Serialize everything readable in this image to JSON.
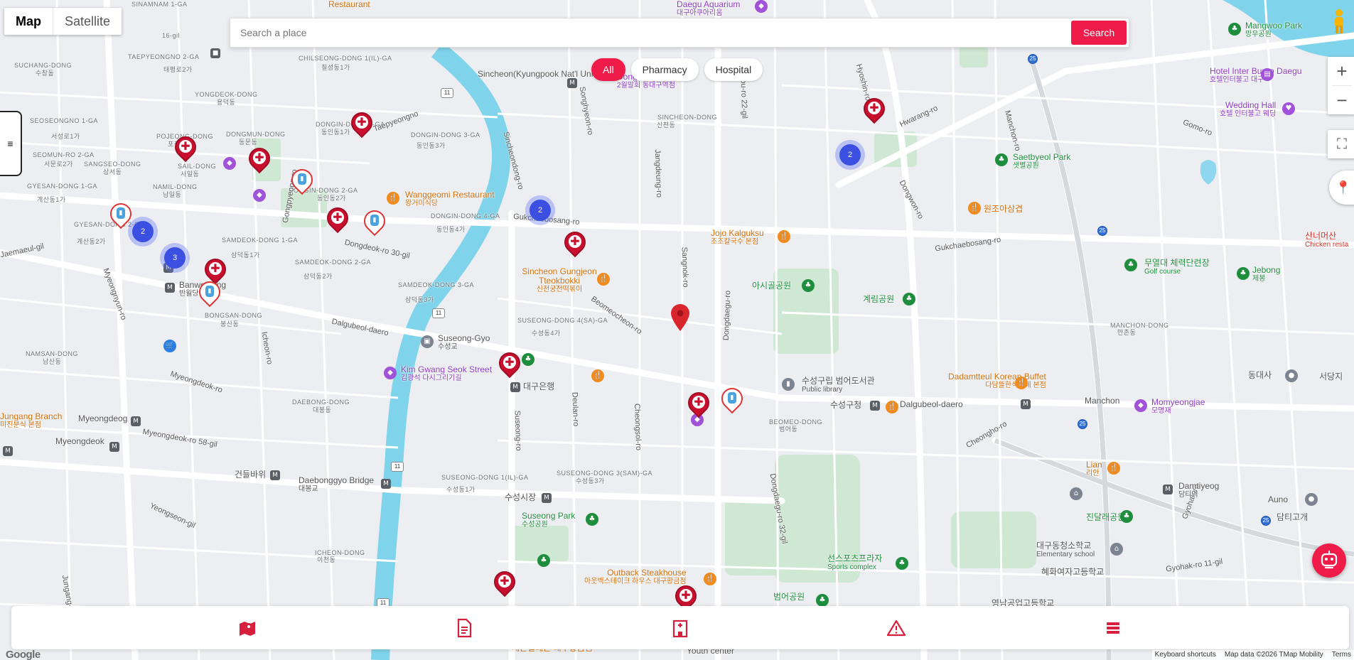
{
  "map_type": {
    "map_label": "Map",
    "satellite_label": "Satellite"
  },
  "search": {
    "placeholder": "Search a place",
    "button_label": "Search"
  },
  "filters": [
    {
      "label": "All",
      "active": true
    },
    {
      "label": "Pharmacy",
      "active": false
    },
    {
      "label": "Hospital",
      "active": false
    }
  ],
  "controls": {
    "zoom_in": "+",
    "zoom_out": "−",
    "fullscreen": "⛶",
    "menu_toggle": "≡"
  },
  "map": {
    "districts": [
      "SINAMNAM 1-GA",
      "16-gil",
      "SUCHANG-DONG",
      "수창동",
      "TAEPYEONGNO 2-GA",
      "태평로2가",
      "SEOSEONGNO 1-GA",
      "서성로1가",
      "SEOMUN-RO 2-GA",
      "서문로2가",
      "SANGSEO-DONG",
      "상서동",
      "GYESAN-DONG 1-GA",
      "계산동1가",
      "NAMIL-DONG",
      "남일동",
      "GYESAN-DONG 2-GA",
      "계산동2가",
      "YONGDEOK-DONG",
      "용덕동",
      "POJEONG-DONG",
      "포정동",
      "SAIL-DONG",
      "사일동",
      "DONGMUN-DONG",
      "동문동",
      "CHILSEONG-DONG 1(IL)-GA",
      "칠성동1가",
      "DONGIN-DONG 1-GA",
      "동인동1가",
      "DONGIN-DONG 2-GA",
      "동인동2가",
      "DONGIN-DONG 3-GA",
      "동인동3가",
      "DONGIN-DONG 4-GA",
      "동인동4가",
      "SAMDEOK-DONG 1-GA",
      "삼덕동1가",
      "SAMDEOK-DONG 2-GA",
      "삼덕동2가",
      "SAMDEOK-DONG 3-GA",
      "삼덕동3가",
      "BONGSAN-DONG",
      "봉산동",
      "NAMSAN-DONG",
      "남산동",
      "DAEBONG-DONG",
      "대봉동",
      "ICHEON-DONG",
      "이천동",
      "SUSEONG-DONG 4(SA)-GA",
      "수성동4가",
      "SUSEONG-DONG 3(SAM)-GA",
      "수성동3가",
      "SUSEONG-DONG 1(IL)-GA",
      "수성동1가",
      "SINCHEON-DONG",
      "신천동",
      "BEOMEO-DONG",
      "범어동",
      "MANCHON-DONG",
      "만촌동"
    ],
    "roads": [
      "Taepyeongno",
      "Dongdeok-ro 30-gil",
      "Gongpyeong-ro",
      "Gukchaebosang-ro",
      "Dalgubeol-daero",
      "Myeongdeok-ro",
      "Myeongnyun-ro",
      "Myeongdeok-ro 58-gil",
      "Icheon-ro",
      "Sincheondong-ro",
      "Songhyeon-ro",
      "Beomeocheon-ro",
      "Sangnok-ro",
      "Jangdeung-ro",
      "Dongdaegu-ro",
      "Dongbu-ro 22-gil",
      "Hwarang-ro",
      "Hyoshin-ro",
      "Manchon-ro",
      "Dongwon-ro",
      "Gomo-ro",
      "Gukchaebosang-ro",
      "Cheongho-ro",
      "Gyohak-ro",
      "Gyohak-ro 11-gil",
      "Jungang-daero",
      "Suseong-ro",
      "Deulan-ro",
      "Cheongsol-ro",
      "Jaemaeul-gil",
      "Yeongseon-gil",
      "Dongdaegu-ro 32-gil"
    ],
    "pois": [
      {
        "name": "Wanggeomi Restaurant",
        "sub": "왕거미식당",
        "color": "orange"
      },
      {
        "name": "Sincheon(Kyungpook Nat'l Univ)",
        "sub": "",
        "color": "gray"
      },
      {
        "name": "Sincheon Gungjeon Tteokbokki",
        "sub": "신천궁전떡볶이",
        "color": "orange"
      },
      {
        "name": "Suseong-Gyo",
        "sub": "수성교",
        "color": "gray"
      },
      {
        "name": "Kim Gwang Seok Street",
        "sub": "김광석 다시그리기길",
        "color": "purple"
      },
      {
        "name": "대구은행",
        "sub": "",
        "color": "gray"
      },
      {
        "name": "Jojo Kalguksu",
        "sub": "조조칼국수 본점",
        "color": "orange"
      },
      {
        "name": "원조아삼겹",
        "sub": "",
        "color": "orange"
      },
      {
        "name": "아시골공원",
        "sub": "",
        "color": "green"
      },
      {
        "name": "계림공원",
        "sub": "",
        "color": "green"
      },
      {
        "name": "수성구립 범어도서관",
        "sub": "Public library",
        "color": "gray"
      },
      {
        "name": "수성구청",
        "sub": "",
        "color": "gray"
      },
      {
        "name": "Dadamtteul Korean Buffet",
        "sub": "다담뜰한식뷔페 본점",
        "color": "orange"
      },
      {
        "name": "Momyeongjae",
        "sub": "모명재",
        "color": "purple"
      },
      {
        "name": "Lian",
        "sub": "리안",
        "color": "orange"
      },
      {
        "name": "진달래공원",
        "sub": "",
        "color": "green"
      },
      {
        "name": "대구동청소학교",
        "sub": "Elementary school",
        "color": "gray"
      },
      {
        "name": "혜화여자고등학교",
        "sub": "",
        "color": "gray"
      },
      {
        "name": "Damtiyeog",
        "sub": "담티역",
        "color": "gray"
      },
      {
        "name": "Auno",
        "sub": "",
        "color": "gray"
      },
      {
        "name": "담티고개",
        "sub": "",
        "color": "gray"
      },
      {
        "name": "동대사",
        "sub": "",
        "color": "gray"
      },
      {
        "name": "서당지",
        "sub": "",
        "color": "gray"
      },
      {
        "name": "Saetbyeol Park",
        "sub": "샛별공원",
        "color": "green"
      },
      {
        "name": "무열대 체력단련장",
        "sub": "Golf course",
        "color": "green"
      },
      {
        "name": "Jebong",
        "sub": "제봉",
        "color": "green"
      },
      {
        "name": "산너머산",
        "sub": "Chicken resta",
        "color": "red"
      },
      {
        "name": "Mangwoo Park",
        "sub": "망우공원",
        "color": "green"
      },
      {
        "name": "Hotel Inter Burgo Daegu",
        "sub": "호텔인터불고 대구",
        "color": "purple"
      },
      {
        "name": "Wedding Hall",
        "sub": "호텔 인터불고 웨딩",
        "color": "purple"
      },
      {
        "name": "Daegu Aquarium",
        "sub": "대구아쿠아리움",
        "color": "purple"
      },
      {
        "name": "Dongdaegu",
        "sub": "2월말회 동대구역점",
        "color": "purple"
      },
      {
        "name": "Suseong Park",
        "sub": "수성공원",
        "color": "green"
      },
      {
        "name": "수성시장",
        "sub": "",
        "color": "gray"
      },
      {
        "name": "Outback Steakhouse",
        "sub": "아웃백스테이크 하우스 대구황금점",
        "color": "orange"
      },
      {
        "name": "선스포츠프라자",
        "sub": "Sports complex",
        "color": "green"
      },
      {
        "name": "범어공원",
        "sub": "",
        "color": "green"
      },
      {
        "name": "Daebonggyo Bridge",
        "sub": "대봉교",
        "color": "gray"
      },
      {
        "name": "건들바위",
        "sub": "",
        "color": "gray"
      },
      {
        "name": "Myeongdeog",
        "sub": "명덕",
        "color": "gray"
      },
      {
        "name": "Myeongdeok",
        "sub": "명덕",
        "color": "gray"
      },
      {
        "name": "Banwoldang",
        "sub": "반월당",
        "color": "gray"
      },
      {
        "name": "Jungang Branch",
        "sub": "미진분식 본점",
        "color": "orange"
      },
      {
        "name": "Manchon",
        "sub": "",
        "color": "gray"
      },
      {
        "name": "Dalgubeol-daero",
        "sub": "",
        "color": "gray"
      },
      {
        "name": "Youth center",
        "sub": "",
        "color": "gray"
      },
      {
        "name": "영남공업고등학교",
        "sub": "",
        "color": "gray"
      },
      {
        "name": "세븐일레븐 대구황금점",
        "sub": "",
        "color": "orange"
      },
      {
        "name": "Restaurant",
        "sub": "",
        "color": "orange"
      }
    ],
    "clusters": [
      "2",
      "2",
      "2",
      "3"
    ]
  },
  "bottom_nav": [
    {
      "icon": "map-marker-icon"
    },
    {
      "icon": "document-icon"
    },
    {
      "icon": "hospital-building-icon"
    },
    {
      "icon": "warning-triangle-icon"
    },
    {
      "icon": "list-icon"
    }
  ],
  "footer": {
    "logo": "Google",
    "shortcuts": "Keyboard shortcuts",
    "map_data": "Map data ©2026 TMap Mobility",
    "terms": "Terms"
  },
  "colors": {
    "accent": "#ef1c4a",
    "pin": "#c8102e",
    "cluster": "#3b4fe0"
  }
}
